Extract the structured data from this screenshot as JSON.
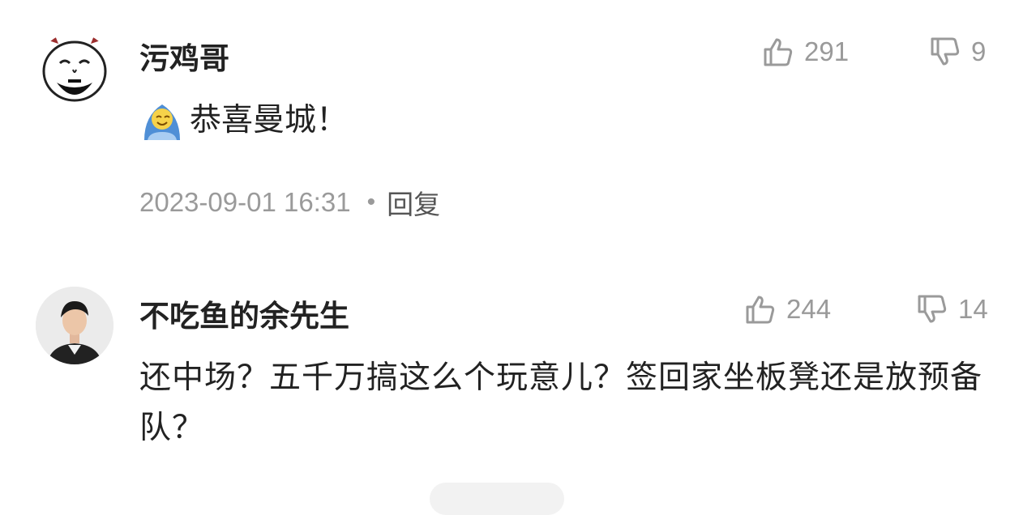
{
  "comments": [
    {
      "username": "污鸡哥",
      "avatar_icon": "cartoon-bearded-face-icon",
      "likes": "291",
      "dislikes": "9",
      "emoji_icon": "blanket-smile-emoji-icon",
      "text": "恭喜曼城！",
      "timestamp": "2023-09-01 16:31",
      "separator": "•",
      "reply_label": "回复"
    },
    {
      "username": "不吃鱼的余先生",
      "avatar_icon": "person-photo-avatar",
      "likes": "244",
      "dislikes": "14",
      "text": "还中场？五千万搞这么个玩意儿？签回家坐板凳还是放预备队？"
    }
  ],
  "colors": {
    "text": "#222222",
    "muted": "#9a9a9a",
    "background": "#ffffff"
  }
}
